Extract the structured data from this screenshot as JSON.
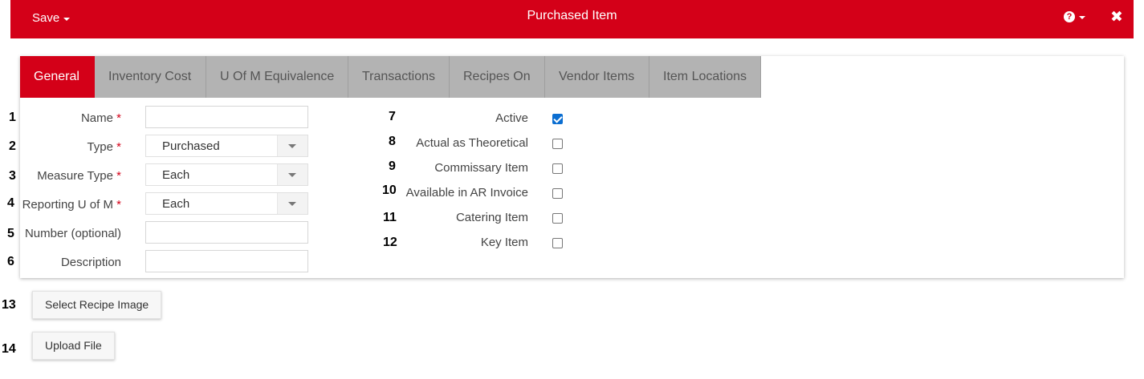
{
  "header": {
    "save_label": "Save",
    "title": "Purchased Item",
    "help_glyph": "?",
    "close_glyph": "✖",
    "background_color": "#d40018"
  },
  "tabs": [
    {
      "label": "General",
      "active": true
    },
    {
      "label": "Inventory Cost",
      "active": false
    },
    {
      "label": "U Of M Equivalence",
      "active": false
    },
    {
      "label": "Transactions",
      "active": false
    },
    {
      "label": "Recipes On",
      "active": false
    },
    {
      "label": "Vendor Items",
      "active": false
    },
    {
      "label": "Item Locations",
      "active": false
    }
  ],
  "form": {
    "required_marker": "*",
    "fields": [
      {
        "num": "1",
        "label": "Name",
        "required": true,
        "kind": "text",
        "value": ""
      },
      {
        "num": "2",
        "label": "Type",
        "required": true,
        "kind": "select",
        "value": "Purchased"
      },
      {
        "num": "3",
        "label": "Measure Type",
        "required": true,
        "kind": "select",
        "value": "Each"
      },
      {
        "num": "4",
        "label": "Reporting U of M",
        "required": true,
        "kind": "select",
        "value": "Each"
      },
      {
        "num": "5",
        "label": "Number (optional)",
        "required": false,
        "kind": "text",
        "value": ""
      },
      {
        "num": "6",
        "label": "Description",
        "required": false,
        "kind": "text",
        "value": ""
      }
    ],
    "checkboxes": [
      {
        "num": "7",
        "label": "Active",
        "checked": true
      },
      {
        "num": "8",
        "label": "Actual as Theoretical",
        "checked": false
      },
      {
        "num": "9",
        "label": "Commissary Item",
        "checked": false
      },
      {
        "num": "10",
        "label": "Available in AR Invoice",
        "checked": false
      },
      {
        "num": "11",
        "label": "Catering Item",
        "checked": false
      },
      {
        "num": "12",
        "label": "Key Item",
        "checked": false
      }
    ]
  },
  "buttons": [
    {
      "num": "13",
      "label": "Select Recipe Image"
    },
    {
      "num": "14",
      "label": "Upload File"
    }
  ],
  "colors": {
    "accent": "#d40018",
    "tab_inactive": "#b3b3b3",
    "checkbox_checked": "#0b6ed1"
  }
}
